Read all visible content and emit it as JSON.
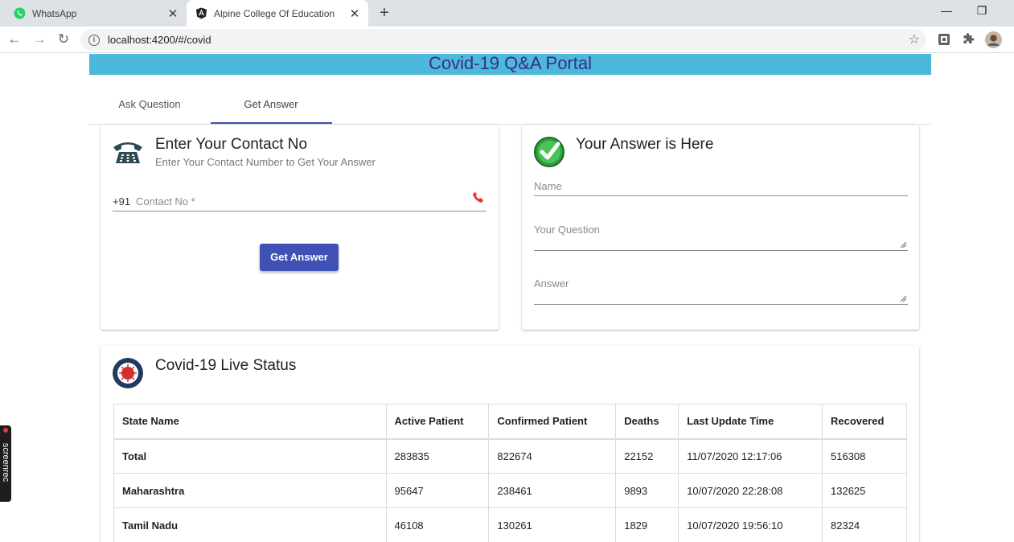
{
  "browser": {
    "tabs": [
      {
        "title": "WhatsApp",
        "icon": "whatsapp-icon"
      },
      {
        "title": "Alpine College Of Education",
        "icon": "angular-icon"
      }
    ],
    "address": "localhost:4200/#/covid"
  },
  "page": {
    "header_title": "Covid-19 Q&A Portal",
    "header_bg": "#4cb8da",
    "tabs": [
      {
        "label": "Ask Question"
      },
      {
        "label": "Get Answer"
      }
    ],
    "accent": "#3f51b5"
  },
  "contact_card": {
    "title": "Enter Your Contact No",
    "subtitle": "Enter Your Contact Number to Get Your Answer",
    "prefix": "+91",
    "contact_label": "Contact No *",
    "button_label": "Get Answer"
  },
  "answer_card": {
    "title": "Your Answer is Here",
    "name_label": "Name",
    "question_label": "Your Question",
    "answer_label": "Answer"
  },
  "status_card": {
    "title": "Covid-19 Live Status",
    "columns": [
      "State Name",
      "Active Patient",
      "Confirmed Patient",
      "Deaths",
      "Last Update Time",
      "Recovered"
    ],
    "rows": [
      [
        "Total",
        "283835",
        "822674",
        "22152",
        "11/07/2020 12:17:06",
        "516308"
      ],
      [
        "Maharashtra",
        "95647",
        "238461",
        "9893",
        "10/07/2020 22:28:08",
        "132625"
      ],
      [
        "Tamil Nadu",
        "46108",
        "130261",
        "1829",
        "10/07/2020 19:56:10",
        "82324"
      ]
    ]
  },
  "overlay": {
    "screenrec_label": "screenrec"
  }
}
